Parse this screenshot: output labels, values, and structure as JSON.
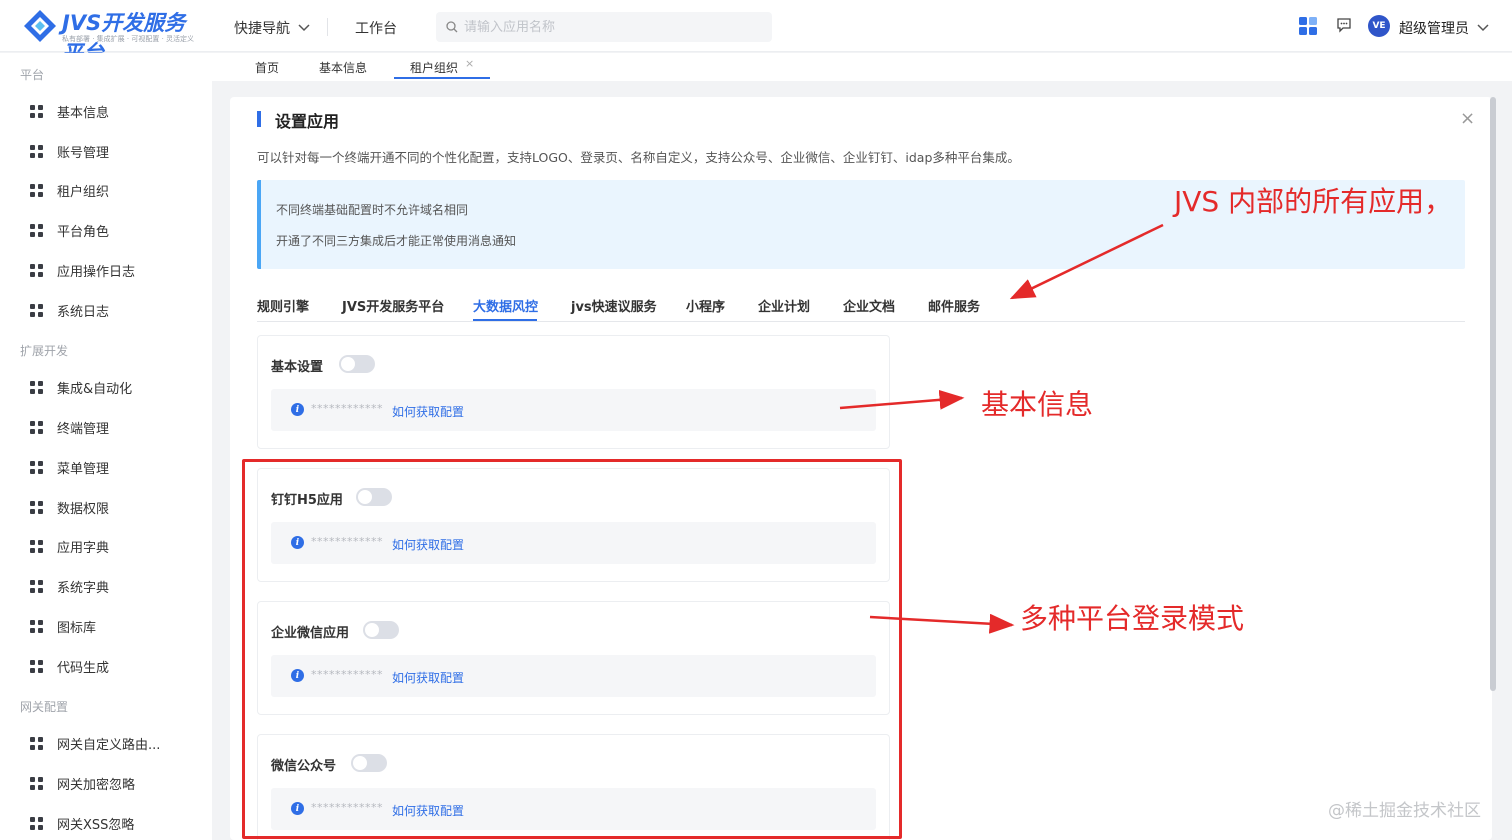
{
  "header": {
    "logo_title": "JVS开发服务平台",
    "logo_subtitle": "私有部署 · 集成扩展 · 可视配置 · 灵活定义",
    "quick_nav": "快捷导航",
    "workbench": "工作台",
    "search_placeholder": "请输入应用名称",
    "avatar_text": "VE",
    "user_name": "超级管理员"
  },
  "sidebar": {
    "groups": [
      "平台",
      "扩展开发",
      "网关配置"
    ],
    "items": [
      "基本信息",
      "账号管理",
      "租户组织",
      "平台角色",
      "应用操作日志",
      "系统日志",
      "集成&自动化",
      "终端管理",
      "菜单管理",
      "数据权限",
      "应用字典",
      "系统字典",
      "图标库",
      "代码生成",
      "网关自定义路由...",
      "网关加密忽略",
      "网关XSS忽略"
    ]
  },
  "tabs": [
    "首页",
    "基本信息",
    "租户组织"
  ],
  "card": {
    "title": "设置应用",
    "description": "可以针对每一个终端开通不同的个性化配置，支持LOGO、登录页、名称自定义，支持公众号、企业微信、企业钉钉、idap多种平台集成。",
    "notice_lines": [
      "不同终端基础配置时不允许域名相同",
      "开通了不同三方集成后才能正常使用消息通知"
    ],
    "app_tabs": [
      "规则引擎",
      "JVS开发服务平台",
      "大数据风控",
      "jvs快速议服务",
      "小程序",
      "企业计划",
      "企业文档",
      "邮件服务"
    ],
    "active_app_tab": "大数据风控",
    "sections": [
      {
        "title": "基本设置",
        "mask": "************",
        "link": "如何获取配置",
        "enabled": false
      },
      {
        "title": "钉钉H5应用",
        "mask": "************",
        "link": "如何获取配置",
        "enabled": false
      },
      {
        "title": "企业微信应用",
        "mask": "************",
        "link": "如何获取配置",
        "enabled": false
      },
      {
        "title": "微信公众号",
        "mask": "************",
        "link": "如何获取配置",
        "enabled": false
      }
    ]
  },
  "annotations": {
    "apps": "JVS 内部的所有应用，",
    "basic": "基本信息",
    "platforms": "多种平台登录模式"
  },
  "watermark": "@稀土掘金技术社区",
  "colors": {
    "accent": "#2f6ee6",
    "annotation": "#e42a2a",
    "notice_bg": "#eaf5fe"
  }
}
